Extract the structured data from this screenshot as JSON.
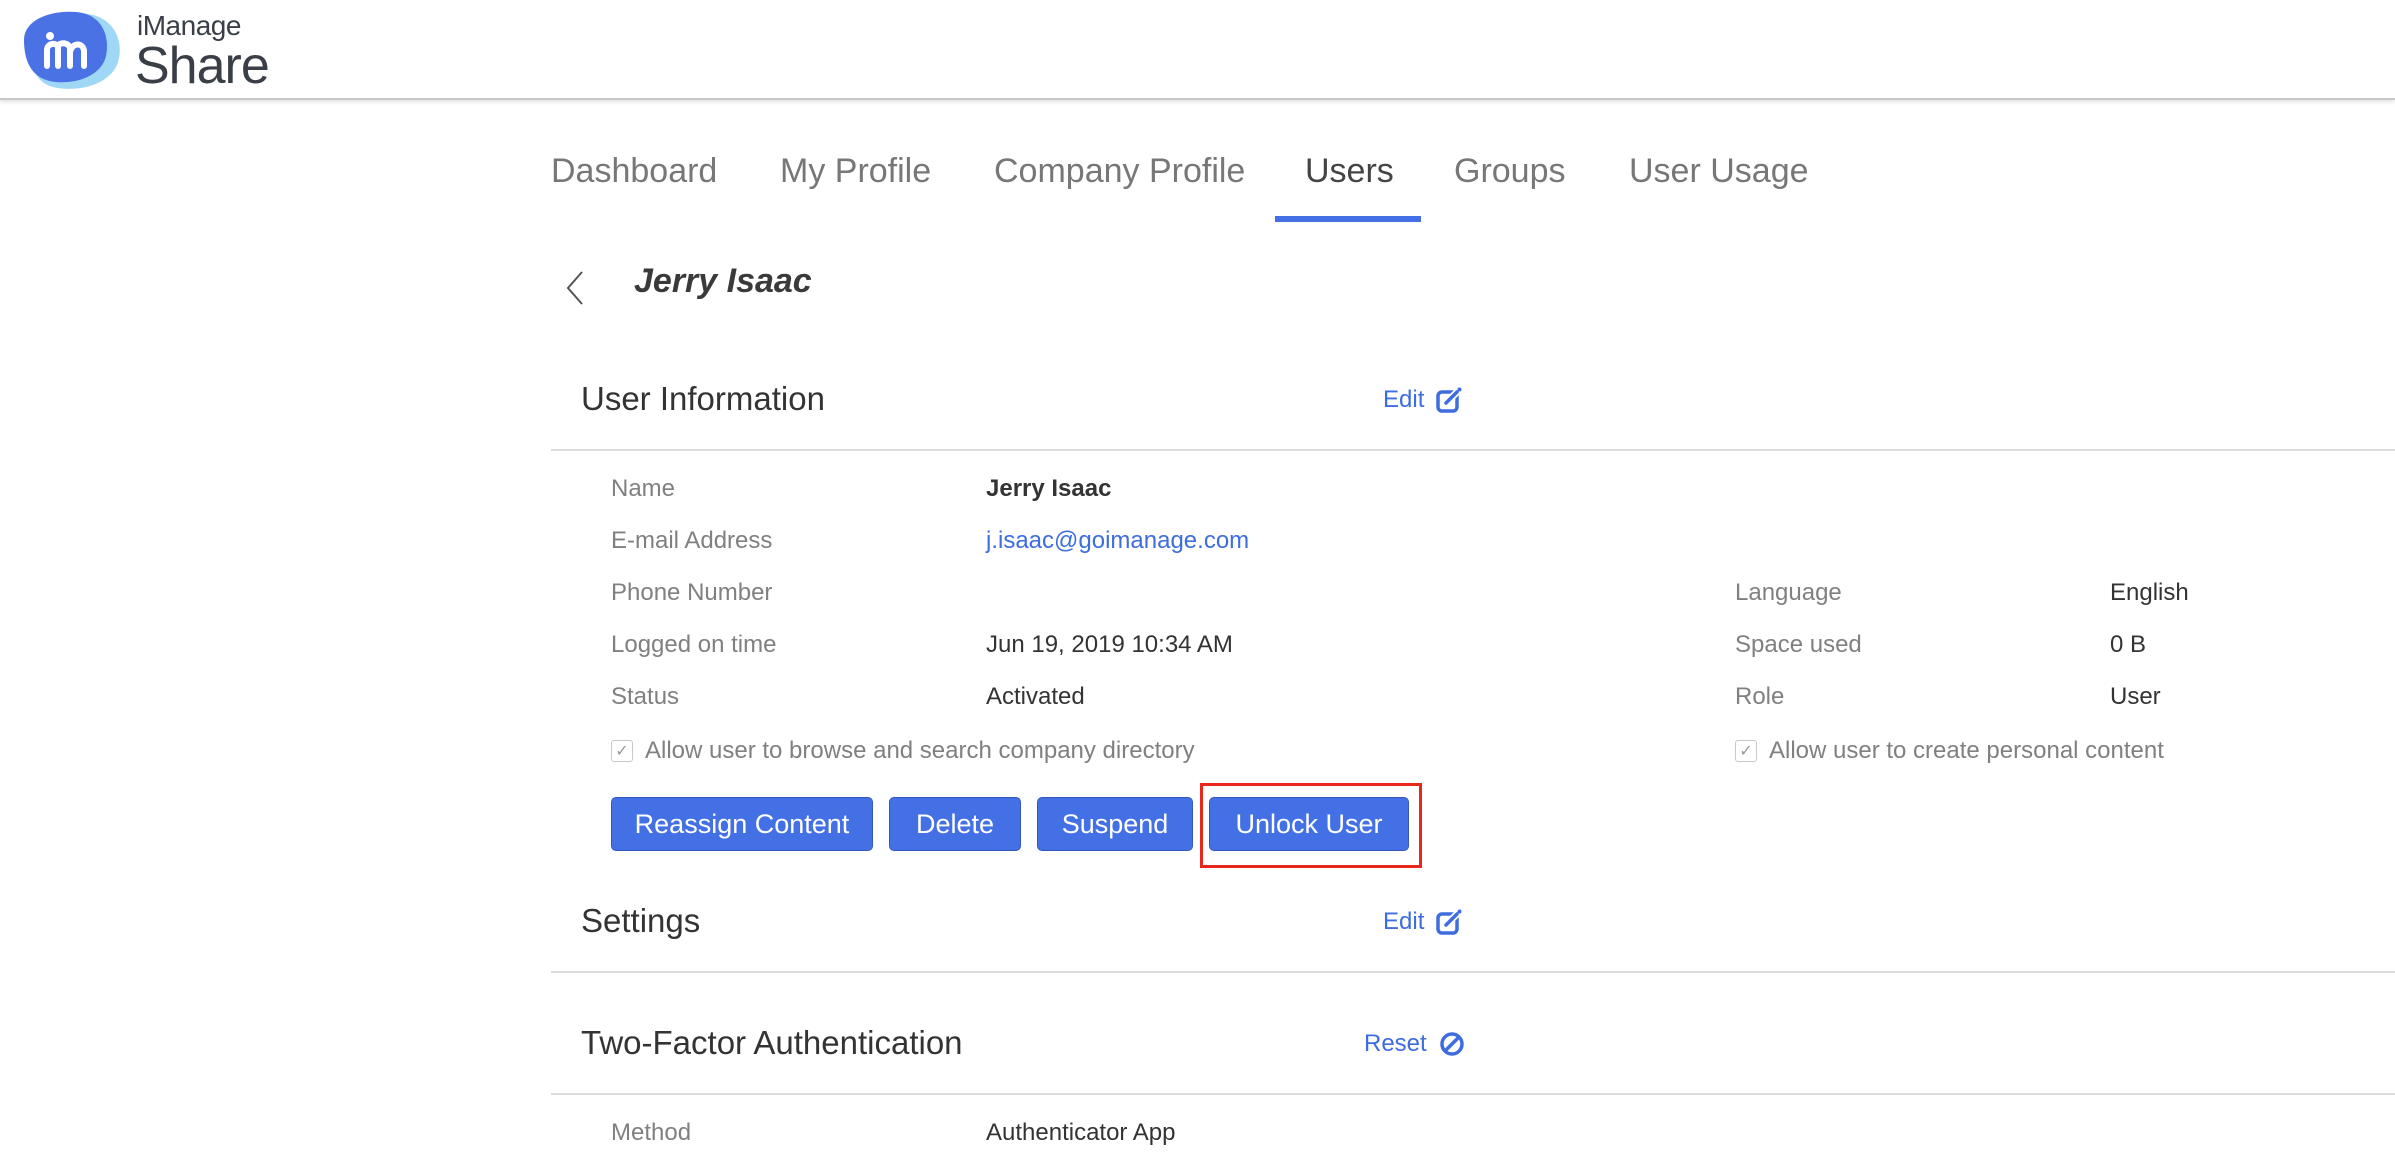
{
  "header": {
    "brand_top": "iManage",
    "brand_main": "Share",
    "logo_icon": "imanage-logo-icon"
  },
  "tabs": [
    {
      "label": "Dashboard",
      "active": false
    },
    {
      "label": "My Profile",
      "active": false
    },
    {
      "label": "Company Profile",
      "active": false
    },
    {
      "label": "Users",
      "active": true
    },
    {
      "label": "Groups",
      "active": false
    },
    {
      "label": "User Usage",
      "active": false
    }
  ],
  "page": {
    "back_icon": "chevron-left-icon",
    "title": "Jerry Isaac"
  },
  "user_information": {
    "title": "User Information",
    "edit_label": "Edit",
    "edit_icon": "edit-icon",
    "left_fields": [
      {
        "label": "Name",
        "value": "Jerry Isaac"
      },
      {
        "label": "E-mail Address",
        "value": "j.isaac@goimanage.com"
      },
      {
        "label": "Phone Number",
        "value": ""
      },
      {
        "label": "Logged on time",
        "value": "Jun 19, 2019 10:34 AM"
      },
      {
        "label": "Status",
        "value": "Activated"
      }
    ],
    "right_fields": [
      {
        "label": "Language",
        "value": "English"
      },
      {
        "label": "Space used",
        "value": "0 B"
      },
      {
        "label": "Role",
        "value": "User"
      }
    ],
    "checkbox_directory": {
      "label": "Allow user to browse and search company directory",
      "checked": true
    },
    "checkbox_personal": {
      "label": "Allow user to create personal content",
      "checked": true
    },
    "buttons": {
      "reassign": "Reassign Content",
      "delete": "Delete",
      "suspend": "Suspend",
      "unlock": "Unlock User"
    }
  },
  "settings": {
    "title": "Settings",
    "edit_label": "Edit"
  },
  "two_factor": {
    "title": "Two-Factor Authentication",
    "reset_label": "Reset",
    "reset_icon": "block-icon",
    "method_label": "Method",
    "method_value": "Authenticator App"
  },
  "colors": {
    "accent": "#4470e6",
    "link": "#3e6de0",
    "highlight": "#e8281b"
  }
}
